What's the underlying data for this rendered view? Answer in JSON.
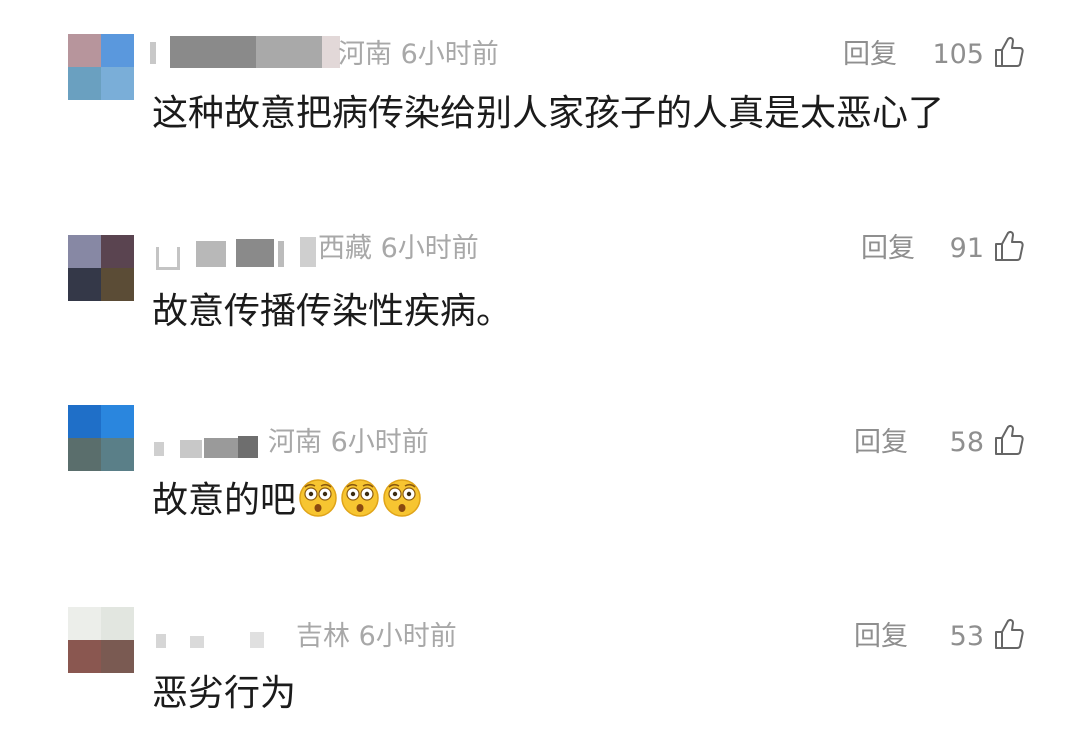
{
  "comments": [
    {
      "location": "河南",
      "time": "6小时前",
      "reply_label": "回复",
      "likes": "105",
      "text": "这种故意把病传染给别人家孩子的人真是太恶心了",
      "avatar_colors": [
        "#b7959c",
        "#5a98dd",
        "#6aa0c0",
        "#7aaed8"
      ]
    },
    {
      "location": "西藏",
      "time": "6小时前",
      "reply_label": "回复",
      "likes": "91",
      "text": "故意传播传染性疾病。",
      "avatar_colors": [
        "#8788a4",
        "#5a4450",
        "#343848",
        "#5b4c36"
      ]
    },
    {
      "location": "河南",
      "time": "6小时前",
      "reply_label": "回复",
      "likes": "58",
      "text": "故意的吧",
      "emoji_count": 3,
      "avatar_colors": [
        "#1f6fc8",
        "#2a86de",
        "#5a6e6c",
        "#5a7f88"
      ]
    },
    {
      "location": "吉林",
      "time": "6小时前",
      "reply_label": "回复",
      "likes": "53",
      "text": "恶劣行为",
      "avatar_colors": [
        "#eceeea",
        "#e2e6e0",
        "#8a5750",
        "#7a5a52"
      ]
    }
  ]
}
